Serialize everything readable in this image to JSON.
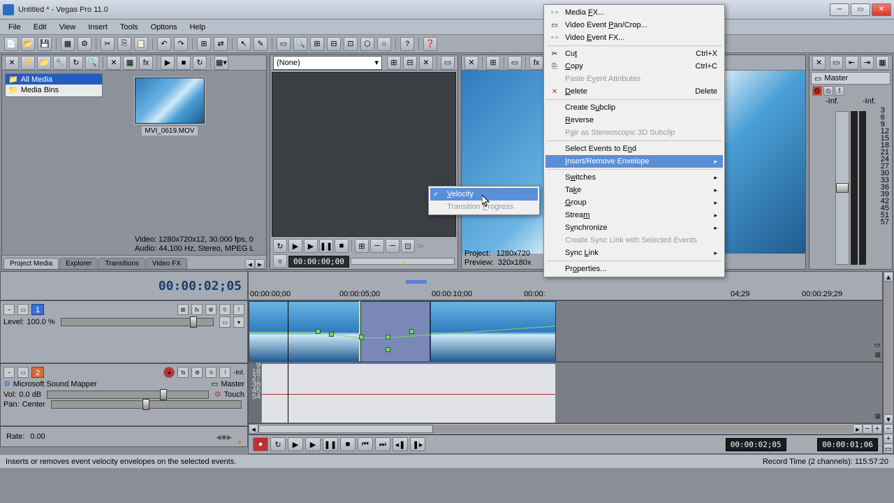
{
  "titlebar": {
    "title": "Untitled * - Vegas Pro 11.0"
  },
  "menubar": [
    "File",
    "Edit",
    "View",
    "Insert",
    "Tools",
    "Options",
    "Help"
  ],
  "project_media": {
    "tree": [
      {
        "label": "All Media",
        "selected": true
      },
      {
        "label": "Media Bins",
        "selected": false
      }
    ],
    "thumb_label": "MVI_0619.MOV",
    "status_line1": "Video: 1280x720x12, 30.000 fps, 0",
    "status_line2": "Audio: 44,100 Hz, Stereo, MPEG L",
    "tabs": [
      "Project Media",
      "Explorer",
      "Transitions",
      "Video FX"
    ]
  },
  "fx_pane": {
    "preset": "(None)",
    "timecode": "00:00:00;00"
  },
  "preview_pane": {
    "project_label": "Project:",
    "project_value": "1280x720",
    "preview_label": "Preview:",
    "preview_value": "320x180x"
  },
  "master_pane": {
    "label": "Master",
    "inf_left": "-Inf.",
    "inf_right": "-Inf.",
    "ticks": [
      "3",
      "6",
      "9",
      "12",
      "15",
      "18",
      "21",
      "24",
      "27",
      "30",
      "33",
      "36",
      "39",
      "42",
      "45",
      "51",
      "57"
    ]
  },
  "timeline": {
    "cursor_time": "00:00:02;05",
    "ruler": [
      "00:00:00;00",
      "00:00:05;00",
      "00:00:10;00",
      "00:00:",
      "04;29",
      "00:00:29;29"
    ],
    "video_track": {
      "num": "1",
      "level_label": "Level:",
      "level_value": "100.0 %"
    },
    "audio_track": {
      "num": "2",
      "device": "Microsoft Sound Mapper",
      "bus": "Master",
      "vol_label": "Vol:",
      "vol_value": "0.0 dB",
      "touch": "Touch",
      "pan_label": "Pan:",
      "pan_value": "Center",
      "inf": "-Inf.",
      "meter_ticks": [
        "9",
        "18",
        "27",
        "36",
        "45",
        "54"
      ]
    },
    "rate_label": "Rate:",
    "rate_value": "0.00",
    "transport_time": "00:00:02;05",
    "record_time": "00:00:01;06"
  },
  "statusbar": {
    "hint": "Inserts or removes event velocity envelopes on the selected events.",
    "record_label": "Record Time (2 channels):",
    "record_value": "115:57:20"
  },
  "context_menu": {
    "items": [
      {
        "label": "Media FX...",
        "icon": "fx"
      },
      {
        "label": "Video Event Pan/Crop...",
        "icon": "crop"
      },
      {
        "label": "Video Event FX...",
        "icon": "fx"
      },
      {
        "sep": true
      },
      {
        "label": "Cut",
        "shortcut": "Ctrl+X",
        "icon": "cut"
      },
      {
        "label": "Copy",
        "shortcut": "Ctrl+C",
        "icon": "copy"
      },
      {
        "label": "Paste Event Attributes",
        "disabled": true
      },
      {
        "label": "Delete",
        "shortcut": "Delete",
        "icon": "del"
      },
      {
        "sep": true
      },
      {
        "label": "Create Subclip"
      },
      {
        "label": "Reverse"
      },
      {
        "label": "Pair as Stereoscopic 3D Subclip",
        "disabled": true
      },
      {
        "sep": true
      },
      {
        "label": "Select Events to End"
      },
      {
        "label": "Insert/Remove Envelope",
        "submenu": true,
        "highlight": true
      },
      {
        "sep": true
      },
      {
        "label": "Switches",
        "submenu": true
      },
      {
        "label": "Take",
        "submenu": true
      },
      {
        "label": "Group",
        "submenu": true
      },
      {
        "label": "Stream",
        "submenu": true
      },
      {
        "label": "Synchronize",
        "submenu": true
      },
      {
        "label": "Create Sync Link with Selected Events",
        "disabled": true
      },
      {
        "label": "Sync Link",
        "submenu": true
      },
      {
        "sep": true
      },
      {
        "label": "Properties..."
      }
    ],
    "submenu": [
      {
        "label": "Velocity",
        "checked": true,
        "highlight": true
      },
      {
        "label": "Transition Progress",
        "disabled": true
      }
    ]
  }
}
